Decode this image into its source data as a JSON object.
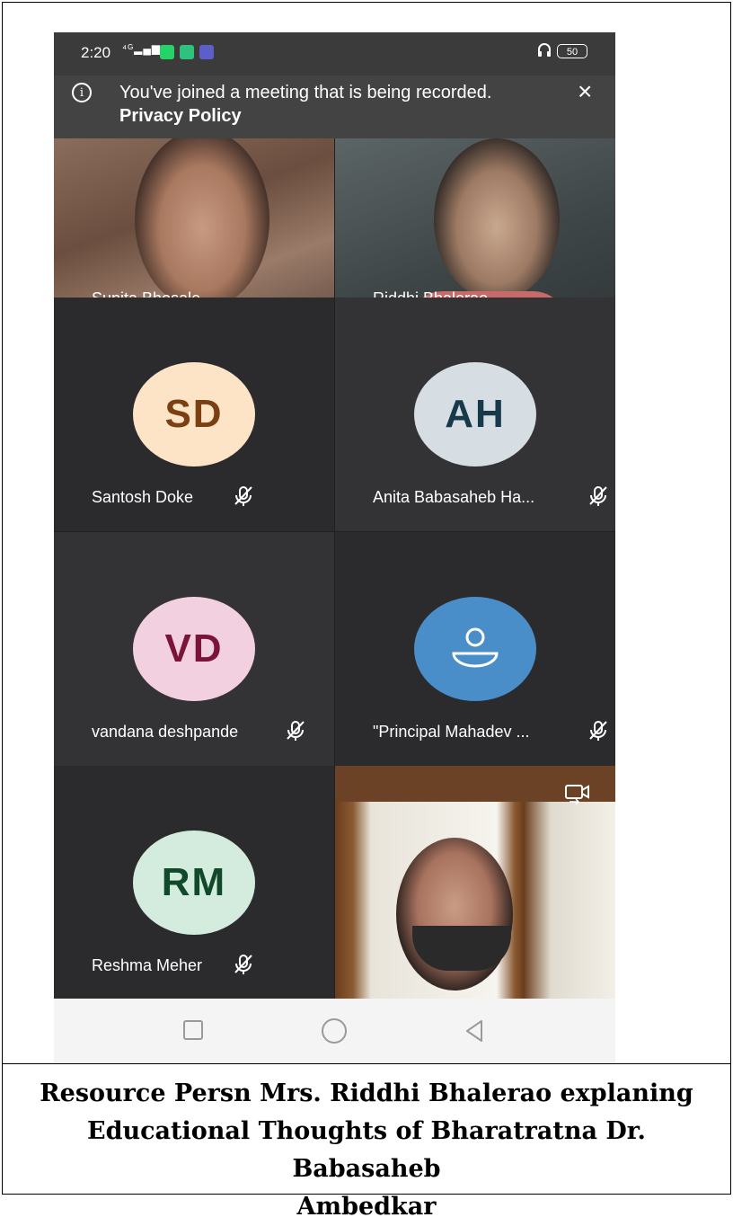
{
  "status_bar": {
    "time": "2:20",
    "network": "⁴ᴳ",
    "battery": "50"
  },
  "banner": {
    "text": "You've joined a meeting that is being recorded.",
    "link": "Privacy Policy"
  },
  "participants": [
    {
      "name": "Sunita Bhosale",
      "type": "video",
      "muted": false
    },
    {
      "name": "Riddhi Bhalerao",
      "type": "video",
      "muted": false
    },
    {
      "name": "Santosh Doke",
      "initials": "SD",
      "avatar_bg": "#fde4c7",
      "avatar_fg": "#7a3f12",
      "muted": true
    },
    {
      "name": "Anita Babasaheb Ha...",
      "initials": "AH",
      "avatar_bg": "#d6dde3",
      "avatar_fg": "#163a4a",
      "muted": true
    },
    {
      "name": "vandana deshpande",
      "initials": "VD",
      "avatar_bg": "#f3d0df",
      "avatar_fg": "#7a1438",
      "muted": true
    },
    {
      "name": "\"Principal Mahadev ...",
      "icon": "person-icon",
      "avatar_bg": "#4a8ec9",
      "muted": true
    },
    {
      "name": "Reshma Meher",
      "initials": "RM",
      "avatar_bg": "#d3ecde",
      "avatar_fg": "#114a2b",
      "muted": true
    },
    {
      "name": "",
      "type": "self-video",
      "icon": "switch-camera-icon"
    }
  ],
  "nav": {
    "icons": [
      "recent-apps-icon",
      "home-icon",
      "back-icon"
    ]
  },
  "caption": {
    "line1": "Resource Persn Mrs. Riddhi Bhalerao explaning",
    "line2": "Educational Thoughts of Bharatratna Dr. Babasaheb",
    "line3": "Ambedkar"
  }
}
